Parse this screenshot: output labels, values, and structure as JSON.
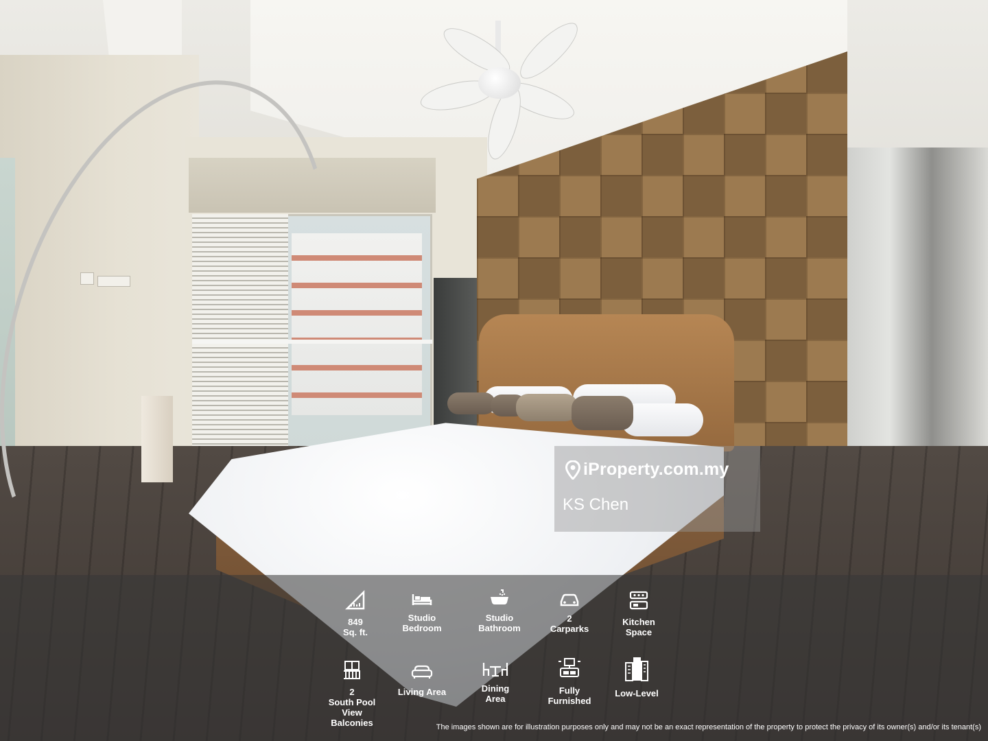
{
  "brand": {
    "name": "iProperty.com.my",
    "agent": "KS Chen"
  },
  "specs": [
    {
      "icon": "ruler-triangle-icon",
      "label": "849\nSq. ft."
    },
    {
      "icon": "bed-icon",
      "label": "Studio\nBedroom"
    },
    {
      "icon": "bathtub-icon",
      "label": "Studio\nBathroom"
    },
    {
      "icon": "car-icon",
      "label": "2\nCarparks"
    },
    {
      "icon": "kitchen-icon",
      "label": "Kitchen\nSpace"
    },
    {
      "icon": "balcony-icon",
      "label": "2\nSouth Pool\nView\nBalconies"
    },
    {
      "icon": "sofa-icon",
      "label": "Living Area"
    },
    {
      "icon": "dining-table-icon",
      "label": "Dining\nArea"
    },
    {
      "icon": "furnished-icon",
      "label": "Fully\nFurnished"
    },
    {
      "icon": "building-icon",
      "label": "Low-Level"
    }
  ],
  "disclaimer": "The images shown are for illustration purposes only and may not be an exact representation of the property to protect the privacy of its owner(s) and/or its tenant(s)",
  "colors": {
    "overlay_text": "#ffffff",
    "panel_bg": "#373737"
  }
}
